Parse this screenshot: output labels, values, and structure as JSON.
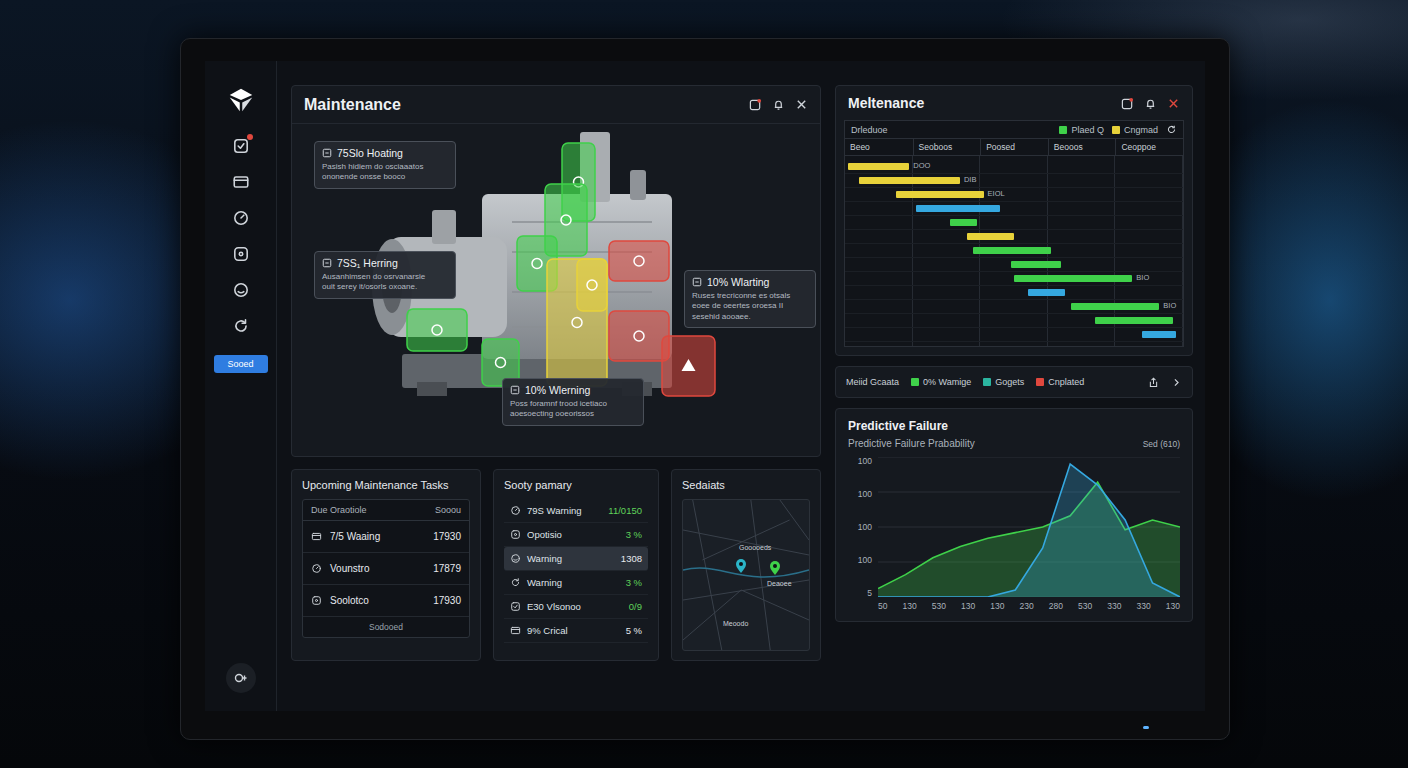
{
  "sidebar": {
    "items": [
      {
        "badge": true
      },
      {
        "badge": false
      },
      {
        "badge": false
      },
      {
        "badge": false
      },
      {
        "badge": false
      },
      {
        "badge": false
      }
    ],
    "button": "Sooed"
  },
  "main_panel": {
    "title": "Maintenance",
    "callouts": [
      {
        "title": "75Slo Hoating",
        "lines": [
          "Pasish hidiem do osciaaatos",
          "ononende onsse booco"
        ]
      },
      {
        "title": "7SS₁ Herring",
        "lines": [
          "Ausanhimsen do osrvanarsie",
          "ouit serey it/osorls oxoane."
        ]
      },
      {
        "title": "10% Wlarting",
        "lines": [
          "Ruses trecriconne es otsals",
          "eoee de oeertes oroesa II",
          "sesehid aooaee."
        ]
      },
      {
        "title": "10% Wlerning",
        "lines": [
          "Poss foramnf trood icetiaco",
          "aoesoecting ooeorissos"
        ]
      }
    ],
    "zones": [
      {
        "color": "#3fd14a"
      },
      {
        "color": "#3fd14a"
      },
      {
        "color": "#3fd14a"
      },
      {
        "color": "#e8d23a"
      },
      {
        "color": "#e8d23a"
      },
      {
        "color": "#e0483e"
      },
      {
        "color": "#e0483e"
      },
      {
        "color": "#e0483e"
      },
      {
        "color": "#3fd14a"
      },
      {
        "color": "#3fd14a"
      }
    ]
  },
  "tasks": {
    "title": "Upcoming Maintenance Tasks",
    "columns": [
      "Due Oraotiole",
      "Sooou"
    ],
    "rows": [
      {
        "label": "7/5 Waaing",
        "value": "17930"
      },
      {
        "label": "Vounstro",
        "value": "17879"
      },
      {
        "label": "Soolotco",
        "value": "17930"
      }
    ],
    "footer": "Sodooed"
  },
  "summary": {
    "title": "Sooty pamary",
    "rows": [
      {
        "label": "79S Warning",
        "value": "11/0150",
        "color": "#5fd35a",
        "selected": false
      },
      {
        "label": "Opotisio",
        "value": "3 %",
        "color": "#5fd35a",
        "selected": false
      },
      {
        "label": "Warning",
        "value": "1308",
        "color": "#e6e9ee",
        "selected": true
      },
      {
        "label": "Warning",
        "value": "3 %",
        "color": "#5fd35a",
        "selected": false
      },
      {
        "label": "E30 Vlsonoo",
        "value": "0/9",
        "color": "#5fd35a",
        "selected": false
      },
      {
        "label": "9% Crical",
        "value": "5 %",
        "color": "#e6e9ee",
        "selected": false
      }
    ]
  },
  "map": {
    "title": "Sedaiats",
    "labels": [
      "Gooooeds",
      "Deaoee",
      "Meoodo"
    ],
    "pins": [
      {
        "color": "#2bb5c8"
      },
      {
        "color": "#3fd14a"
      }
    ]
  },
  "schedule": {
    "title": "Meltenance",
    "subtitle": "Drleduoe",
    "legend": [
      {
        "label": "Plaed Q",
        "color": "#3fd14a"
      },
      {
        "label": "Cngmad",
        "color": "#e8d23a"
      }
    ],
    "columns": [
      "Beeo",
      "Seoboos",
      "Poosed",
      "Beooos",
      "Ceoppoe"
    ],
    "bars": [
      {
        "start": 1,
        "end": 19,
        "color": "#e8d23a",
        "label": "DOO"
      },
      {
        "start": 4,
        "end": 34,
        "color": "#e8d23a",
        "label": "DIB"
      },
      {
        "start": 15,
        "end": 41,
        "color": "#e8d23a",
        "label": "EIOL"
      },
      {
        "start": 21,
        "end": 46,
        "color": "#35a8e0"
      },
      {
        "start": 31,
        "end": 39,
        "color": "#3fd14a"
      },
      {
        "start": 36,
        "end": 50,
        "color": "#e8d23a"
      },
      {
        "start": 38,
        "end": 61,
        "color": "#3fd14a"
      },
      {
        "start": 49,
        "end": 64,
        "color": "#3fd14a"
      },
      {
        "start": 50,
        "end": 85,
        "color": "#3fd14a",
        "label": "BIO"
      },
      {
        "start": 54,
        "end": 65,
        "color": "#35a8e0"
      },
      {
        "start": 67,
        "end": 93,
        "color": "#3fd14a",
        "label": "BIO"
      },
      {
        "start": 74,
        "end": 97,
        "color": "#3fd14a"
      },
      {
        "start": 88,
        "end": 98,
        "color": "#35a8e0"
      }
    ]
  },
  "status_legend": {
    "title": "Meiid Gcaata",
    "items": [
      {
        "label": "0% Wamige",
        "color": "#3fd14a"
      },
      {
        "label": "Gogets",
        "color": "#2bb5a0"
      },
      {
        "label": "Cnplated",
        "color": "#e0483e"
      }
    ]
  },
  "failure_chart": {
    "title": "Predictive Failure",
    "subtitle": "Predictive Failure Prabability",
    "note": "Sed (610)",
    "y_ticks": [
      "100",
      "100",
      "100",
      "100",
      "5"
    ],
    "x_ticks": [
      "50",
      "130",
      "530",
      "130",
      "130",
      "230",
      "280",
      "530",
      "330",
      "330",
      "130"
    ],
    "series": [
      {
        "color": "#3fd14a",
        "values": [
          6,
          16,
          28,
          36,
          42,
          46,
          50,
          58,
          82,
          48,
          55,
          50
        ]
      },
      {
        "color": "#35a8e0",
        "values": [
          0,
          0,
          0,
          0,
          0,
          5,
          35,
          95,
          80,
          55,
          10,
          0
        ]
      }
    ]
  }
}
